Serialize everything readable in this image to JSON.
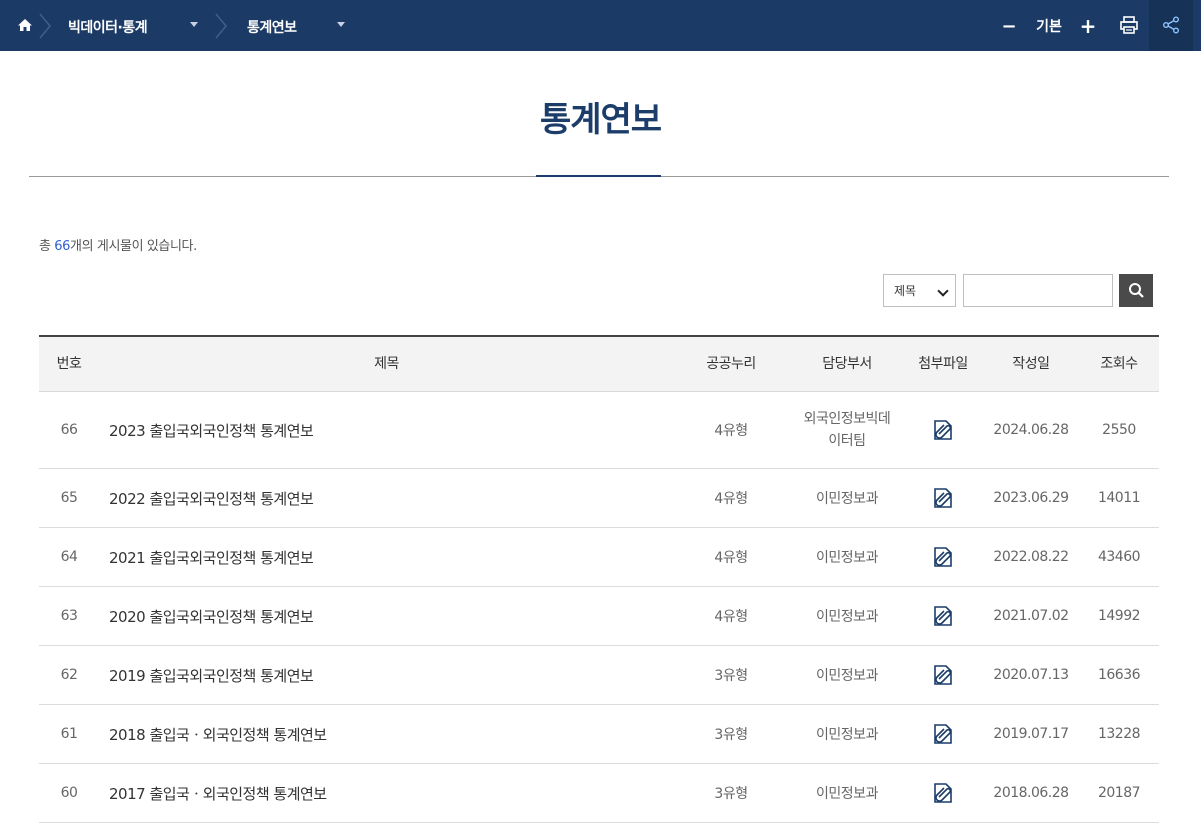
{
  "topbar": {
    "crumb1": "빅데이터·통계",
    "crumb2": "통계연보",
    "font_minus": "−",
    "font_label": "기본",
    "font_plus": "+"
  },
  "page_title": "통계연보",
  "count": {
    "prefix": "총",
    "number": "66",
    "suffix": "개의 게시물이 있습니다."
  },
  "search": {
    "select_value": "제목",
    "input_value": ""
  },
  "table": {
    "headers": {
      "no": "번호",
      "title": "제목",
      "nuri": "공공누리",
      "dept": "담당부서",
      "file": "첨부파일",
      "date": "작성일",
      "views": "조회수"
    },
    "rows": [
      {
        "no": "66",
        "title": "2023 출입국외국인정책 통계연보",
        "nuri": "4유형",
        "dept": "외국인정보빅데\n이터팀",
        "date": "2024.06.28",
        "views": "2550"
      },
      {
        "no": "65",
        "title": "2022 출입국외국인정책 통계연보",
        "nuri": "4유형",
        "dept": "이민정보과",
        "date": "2023.06.29",
        "views": "14011"
      },
      {
        "no": "64",
        "title": "2021 출입국외국인정책 통계연보",
        "nuri": "4유형",
        "dept": "이민정보과",
        "date": "2022.08.22",
        "views": "43460"
      },
      {
        "no": "63",
        "title": "2020 출입국외국인정책 통계연보",
        "nuri": "4유형",
        "dept": "이민정보과",
        "date": "2021.07.02",
        "views": "14992"
      },
      {
        "no": "62",
        "title": "2019 출입국외국인정책 통계연보",
        "nuri": "3유형",
        "dept": "이민정보과",
        "date": "2020.07.13",
        "views": "16636"
      },
      {
        "no": "61",
        "title": "2018 출입국ㆍ외국인정책 통계연보",
        "nuri": "3유형",
        "dept": "이민정보과",
        "date": "2019.07.17",
        "views": "13228"
      },
      {
        "no": "60",
        "title": "2017 출입국ㆍ외국인정책 통계연보",
        "nuri": "3유형",
        "dept": "이민정보과",
        "date": "2018.06.28",
        "views": "20187"
      }
    ]
  },
  "icons": {
    "home": "home-icon",
    "print": "print-icon",
    "share": "share-icon",
    "search": "search-icon",
    "attachment": "attachment-icon"
  },
  "colors": {
    "topbar": "#1b3a66",
    "title": "#1c3d6a",
    "count_number": "#2f5fd0"
  }
}
